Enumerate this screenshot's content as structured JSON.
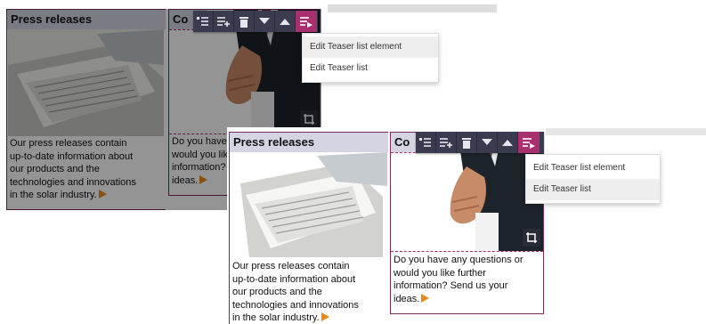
{
  "left_card": {
    "title": "Press releases",
    "lines": [
      "Our press releases contain",
      "up-to-date information about",
      "our products and the",
      "technologies and innovations",
      "in the solar industry."
    ],
    "more_icon": "play-icon"
  },
  "right_card": {
    "title": "Co",
    "lines": [
      "Do you have any questions or",
      "would you like further",
      "information? Send us your",
      "ideas."
    ],
    "more_icon": "play-icon"
  },
  "toolbar": {
    "buttons": [
      "list-icon",
      "list-add-icon",
      "trash-icon",
      "chevron-down-icon",
      "chevron-up-icon",
      "edit-list-icon"
    ]
  },
  "context_menu": {
    "items": [
      "Edit Teaser list element",
      "Edit Teaser list"
    ]
  },
  "colors": {
    "frame": "#7a2e5e",
    "title_bg": "#d4d4e2",
    "toolbar_bg": "#3b3b4f",
    "toolbar_active": "#a8306f",
    "arrow": "#e88a1a"
  }
}
